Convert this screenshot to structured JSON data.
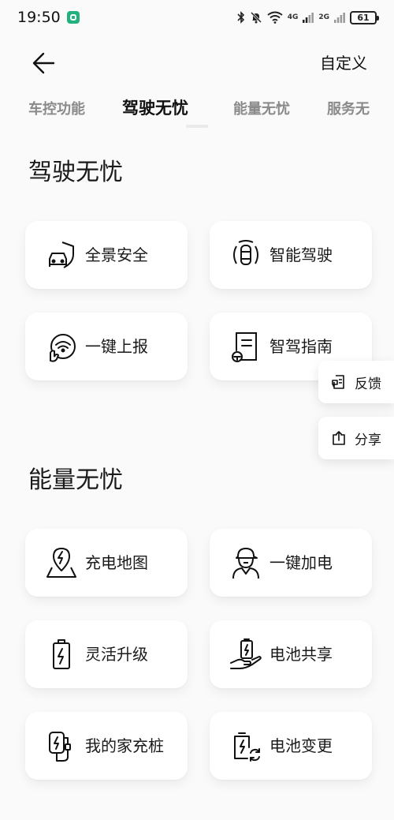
{
  "status_bar": {
    "time": "19:50",
    "network_1": "4G",
    "network_2": "2G",
    "battery": "61"
  },
  "header": {
    "customize_label": "自定义"
  },
  "tabs": [
    {
      "label": "车控功能"
    },
    {
      "label": "驾驶无忧"
    },
    {
      "label": "能量无忧"
    },
    {
      "label": "服务无"
    }
  ],
  "sections": [
    {
      "title": "驾驶无忧",
      "items": [
        {
          "label": "全景安全",
          "icon": "shield-car-icon"
        },
        {
          "label": "智能驾驶",
          "icon": "smart-driving-icon"
        },
        {
          "label": "一键上报",
          "icon": "report-icon"
        },
        {
          "label": "智驾指南",
          "icon": "guide-icon"
        }
      ]
    },
    {
      "title": "能量无忧",
      "items": [
        {
          "label": "充电地图",
          "icon": "charging-map-icon"
        },
        {
          "label": "一键加电",
          "icon": "service-person-icon"
        },
        {
          "label": "灵活升级",
          "icon": "battery-icon"
        },
        {
          "label": "电池共享",
          "icon": "battery-share-icon"
        },
        {
          "label": "我的家充桩",
          "icon": "home-charger-icon"
        },
        {
          "label": "电池变更",
          "icon": "battery-change-icon"
        }
      ]
    }
  ],
  "floating": {
    "feedback_label": "反馈",
    "share_label": "分享"
  },
  "colors": {
    "background": "#fafafa",
    "tile": "#ffffff",
    "active_tab": "#111111",
    "inactive_tab": "#8a8a8a"
  }
}
